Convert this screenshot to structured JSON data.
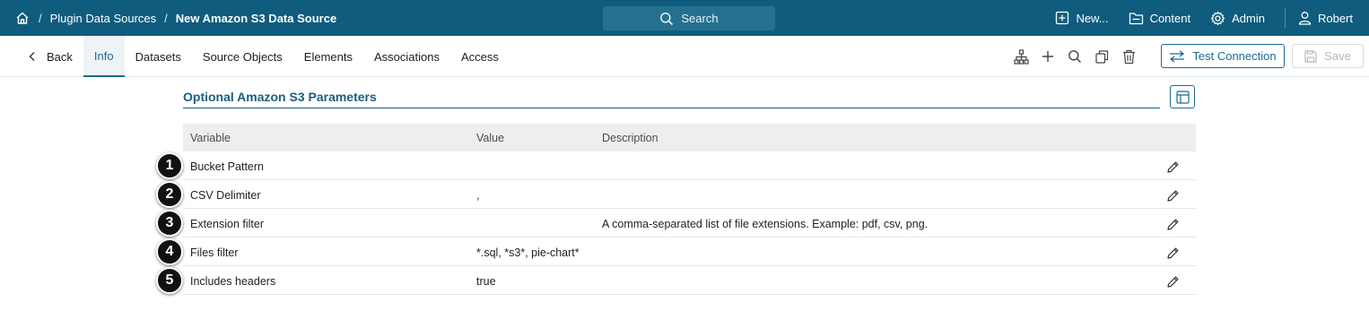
{
  "topbar": {
    "breadcrumbs": [
      "Plugin Data Sources",
      "New Amazon S3 Data Source"
    ],
    "search_label": "Search",
    "new_label": "New...",
    "content_label": "Content",
    "admin_label": "Admin",
    "user_label": "Robert",
    "bg_color": "#0f5c7e"
  },
  "tabbar": {
    "back_label": "Back",
    "tabs": [
      "Info",
      "Datasets",
      "Source Objects",
      "Elements",
      "Associations",
      "Access"
    ],
    "active_tab": "Info",
    "test_connection_label": "Test Connection",
    "save_label": "Save"
  },
  "section": {
    "title": "Optional Amazon S3 Parameters"
  },
  "table": {
    "headers": [
      "Variable",
      "Value",
      "Description"
    ],
    "rows": [
      {
        "badge": "1",
        "variable": "Bucket Pattern",
        "value": "",
        "description": ""
      },
      {
        "badge": "2",
        "variable": "CSV Delimiter",
        "value": ",",
        "description": ""
      },
      {
        "badge": "3",
        "variable": "Extension filter",
        "value": "",
        "description": "A comma-separated list of file extensions. Example: pdf, csv, png."
      },
      {
        "badge": "4",
        "variable": "Files filter",
        "value": "*.sql, *s3*, pie-chart*",
        "description": ""
      },
      {
        "badge": "5",
        "variable": "Includes headers",
        "value": "true",
        "description": ""
      }
    ]
  },
  "colors": {
    "accent": "#1b6a92",
    "header_bg": "#eeeeee"
  }
}
